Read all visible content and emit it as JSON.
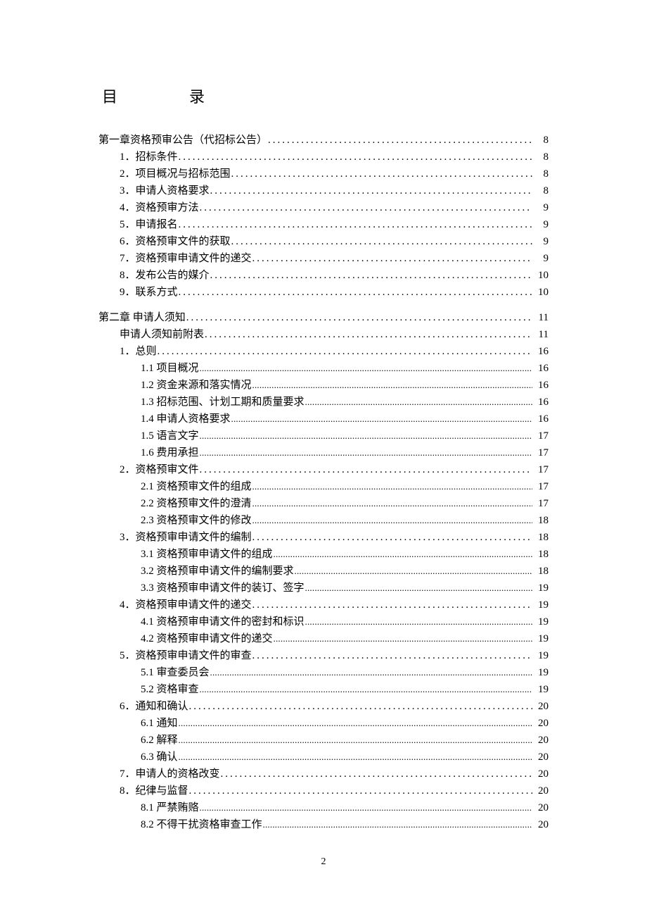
{
  "title": "目　录",
  "page_number": "2",
  "toc": [
    {
      "level": 0,
      "label": "第一章资格预审公告（代招标公告）",
      "page": "8",
      "leader": "dots"
    },
    {
      "level": 1,
      "label": "1．招标条件",
      "page": "8",
      "leader": "dots"
    },
    {
      "level": 1,
      "label": "2．项目概况与招标范围",
      "page": "8",
      "leader": "dots"
    },
    {
      "level": 1,
      "label": "3．申请人资格要求",
      "page": "8",
      "leader": "dots"
    },
    {
      "level": 1,
      "label": "4．资格预审方法",
      "page": "9",
      "leader": "dots"
    },
    {
      "level": 1,
      "label": "5．申请报名",
      "page": "9",
      "leader": "dots"
    },
    {
      "level": 1,
      "label": "6．资格预审文件的获取",
      "page": "9",
      "leader": "dots"
    },
    {
      "level": 1,
      "label": "7．资格预审申请文件的递交",
      "page": "9",
      "leader": "dots"
    },
    {
      "level": 1,
      "label": "8．发布公告的媒介",
      "page": "10",
      "leader": "dots"
    },
    {
      "level": 1,
      "label": "9．联系方式",
      "page": "10",
      "leader": "dots"
    },
    {
      "gap": true
    },
    {
      "level": 0,
      "label": "第二章  申请人须知",
      "page": "11",
      "leader": "dots"
    },
    {
      "level": 1,
      "label": "申请人须知前附表",
      "page": "11",
      "leader": "dots"
    },
    {
      "level": 1,
      "label": "1．总则",
      "page": "16",
      "leader": "dots"
    },
    {
      "level": 2,
      "label": "1.1 项目概况",
      "page": "16",
      "leader": "fine"
    },
    {
      "level": 2,
      "label": "1.2 资金来源和落实情况",
      "page": "16",
      "leader": "fine"
    },
    {
      "level": 2,
      "label": "1.3 招标范围、计划工期和质量要求",
      "page": "16",
      "leader": "fine"
    },
    {
      "level": 2,
      "label": "1.4 申请人资格要求",
      "page": "16",
      "leader": "fine"
    },
    {
      "level": 2,
      "label": "1.5 语言文字",
      "page": "17",
      "leader": "fine"
    },
    {
      "level": 2,
      "label": "1.6 费用承担",
      "page": "17",
      "leader": "fine"
    },
    {
      "level": 1,
      "label": "2．资格预审文件",
      "page": "17",
      "leader": "dots"
    },
    {
      "level": 2,
      "label": "2.1 资格预审文件的组成",
      "page": "17",
      "leader": "fine"
    },
    {
      "level": 2,
      "label": "2.2 资格预审文件的澄清",
      "page": "17",
      "leader": "fine"
    },
    {
      "level": 2,
      "label": "2.3 资格预审文件的修改",
      "page": "18",
      "leader": "fine"
    },
    {
      "level": 1,
      "label": "3．资格预审申请文件的编制",
      "page": "18",
      "leader": "dots"
    },
    {
      "level": 2,
      "label": "3.1 资格预审申请文件的组成",
      "page": "18",
      "leader": "fine"
    },
    {
      "level": 2,
      "label": "3.2 资格预审申请文件的编制要求",
      "page": "18",
      "leader": "fine"
    },
    {
      "level": 2,
      "label": "3.3 资格预审申请文件的装订、签字",
      "page": "19",
      "leader": "fine"
    },
    {
      "level": 1,
      "label": "4．资格预审申请文件的递交",
      "page": "19",
      "leader": "dots"
    },
    {
      "level": 2,
      "label": "4.1 资格预审申请文件的密封和标识",
      "page": "19",
      "leader": "fine"
    },
    {
      "level": 2,
      "label": "4.2 资格预审申请文件的递交",
      "page": "19",
      "leader": "fine"
    },
    {
      "level": 1,
      "label": "5．资格预审申请文件的审查",
      "page": "19",
      "leader": "dots"
    },
    {
      "level": 2,
      "label": "5.1 审查委员会",
      "page": "19",
      "leader": "fine"
    },
    {
      "level": 2,
      "label": "5.2 资格审查",
      "page": "19",
      "leader": "fine"
    },
    {
      "level": 1,
      "label": "6．通知和确认",
      "page": "20",
      "leader": "dots"
    },
    {
      "level": 2,
      "label": "6.1 通知",
      "page": "20",
      "leader": "fine"
    },
    {
      "level": 2,
      "label": "6.2 解释",
      "page": "20",
      "leader": "fine"
    },
    {
      "level": 2,
      "label": "6.3 确认",
      "page": "20",
      "leader": "fine"
    },
    {
      "level": 1,
      "label": "7．申请人的资格改变",
      "page": "20",
      "leader": "dots"
    },
    {
      "level": 1,
      "label": "8．纪律与监督",
      "page": "20",
      "leader": "dots"
    },
    {
      "level": 2,
      "label": "8.1 严禁贿赂",
      "page": "20",
      "leader": "fine"
    },
    {
      "level": 2,
      "label": "8.2 不得干扰资格审查工作",
      "page": "20",
      "leader": "fine"
    }
  ]
}
